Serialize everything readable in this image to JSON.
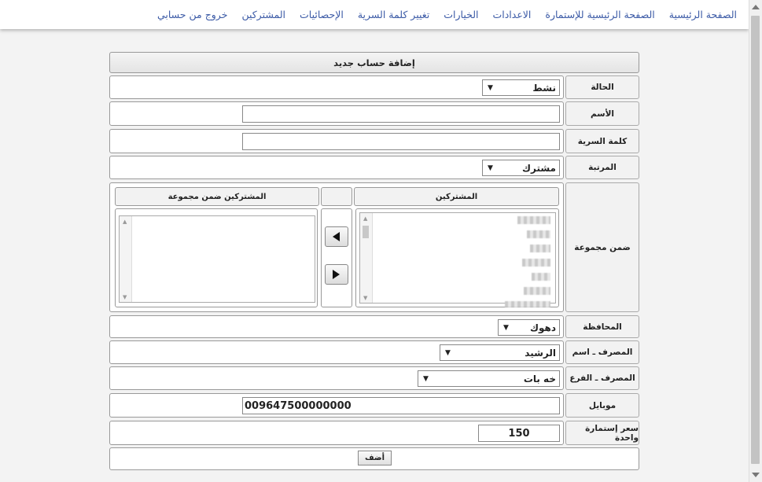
{
  "nav": [
    {
      "label": "الصفحة الرئيسية"
    },
    {
      "label": "الصفحة الرئيسية للإستمارة"
    },
    {
      "label": "الاعدادات"
    },
    {
      "label": "الخيارات"
    },
    {
      "label": "تغيير كلمة السرية"
    },
    {
      "label": "الإحصائيات"
    },
    {
      "label": "المشتركين"
    },
    {
      "label": "خروج من حسابي"
    }
  ],
  "form": {
    "title": "إضافة حساب جديد",
    "status": {
      "label": "الحالة",
      "value": "نشط"
    },
    "name": {
      "label": "الأسم",
      "value": ""
    },
    "password": {
      "label": "كلمة السرية",
      "value": ""
    },
    "rank": {
      "label": "المرتبة",
      "value": "مشترك"
    },
    "group": {
      "label": "ضمن مجموعة",
      "subscribers_header": "المشتركين",
      "group_members_header": "المشتركين ضمن مجموعة"
    },
    "governorate": {
      "label": "المحافظة",
      "value": "دهوك"
    },
    "bank_name": {
      "label": "المصرف ـ اسم",
      "value": "الرشيد"
    },
    "bank_branch": {
      "label": "المصرف ـ الفرع",
      "value": "خه بات"
    },
    "mobile": {
      "label": "موبايل",
      "value": "009647500000000"
    },
    "price": {
      "label": "سعر إستمارة واحدة",
      "value": "150"
    },
    "submit_label": "أضف"
  }
}
